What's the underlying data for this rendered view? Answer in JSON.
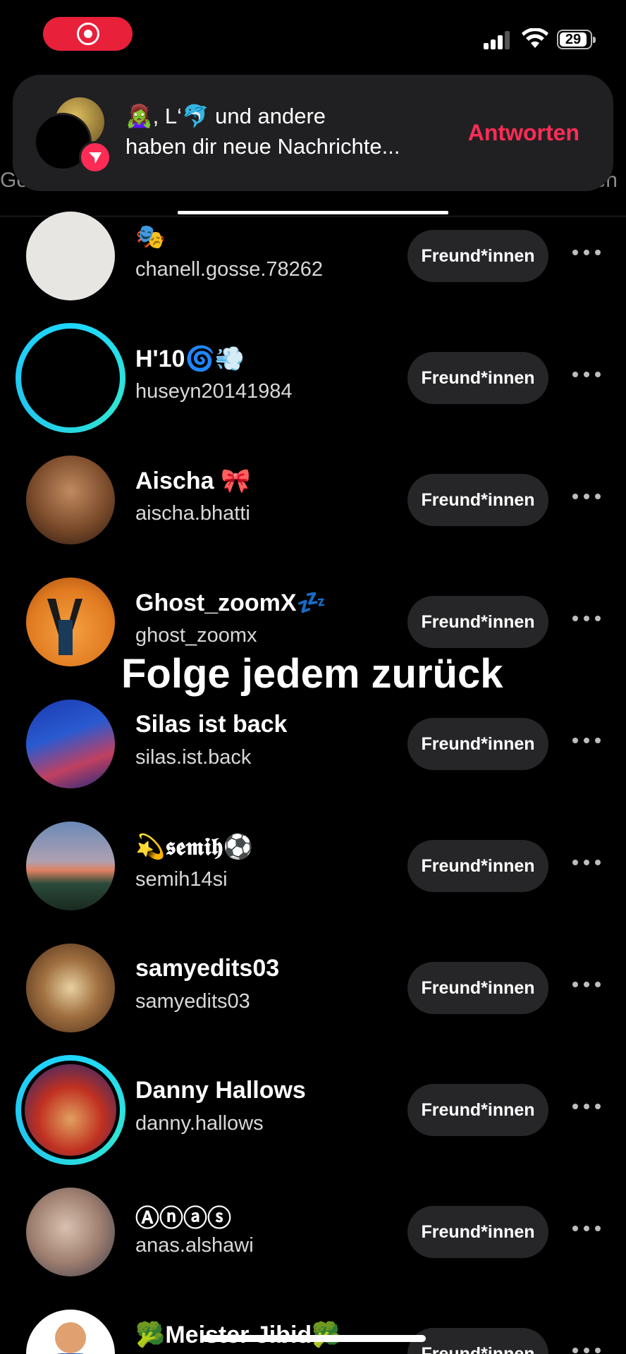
{
  "status_bar": {
    "battery": "29",
    "recording_color": "#e8203a"
  },
  "tabs": {
    "left_partial": "Ge",
    "right_partial": "en"
  },
  "notification": {
    "line1": "🧟‍♀️, L‘🐬 und andere",
    "line2": "haben dir neue Nachrichte...",
    "reply_label": "Antworten",
    "accent": "#fe2c55"
  },
  "list": {
    "button_label": "Freund*innen",
    "rows": [
      {
        "name": "🎭",
        "username": "chanell.gosse.78262",
        "avatar": "light-gray",
        "ring": false
      },
      {
        "name": "H'10🌀💨",
        "username": "huseyn20141984",
        "avatar": "black",
        "ring": true
      },
      {
        "name": "Aischa 🎀",
        "username": "aischa.bhatti",
        "avatar": "cartoon-girl",
        "ring": false
      },
      {
        "name": "Ghost_zoomX💤",
        "username": "ghost_zoomx",
        "avatar": "orange-figure",
        "ring": false
      },
      {
        "name": "Silas ist back",
        "username": "silas.ist.back",
        "avatar": "game-card",
        "ring": false
      },
      {
        "name": "💫𝖘𝖊𝖒𝖎𝖍⚽",
        "username": "semih14si",
        "avatar": "sunset-road",
        "ring": false
      },
      {
        "name": "samyedits03",
        "username": "samyedits03",
        "avatar": "food",
        "ring": false
      },
      {
        "name": "Danny Hallows",
        "username": "danny.hallows",
        "avatar": "world-poster",
        "ring": true
      },
      {
        "name": "Ⓐⓝⓐⓢ",
        "username": "anas.alshawi",
        "avatar": "selfie",
        "ring": false
      },
      {
        "name": "🥦Meister Jibid🥦",
        "username": "",
        "avatar": "cartoon-man",
        "ring": false
      }
    ]
  },
  "overlay_caption": "Folge jedem zurück"
}
